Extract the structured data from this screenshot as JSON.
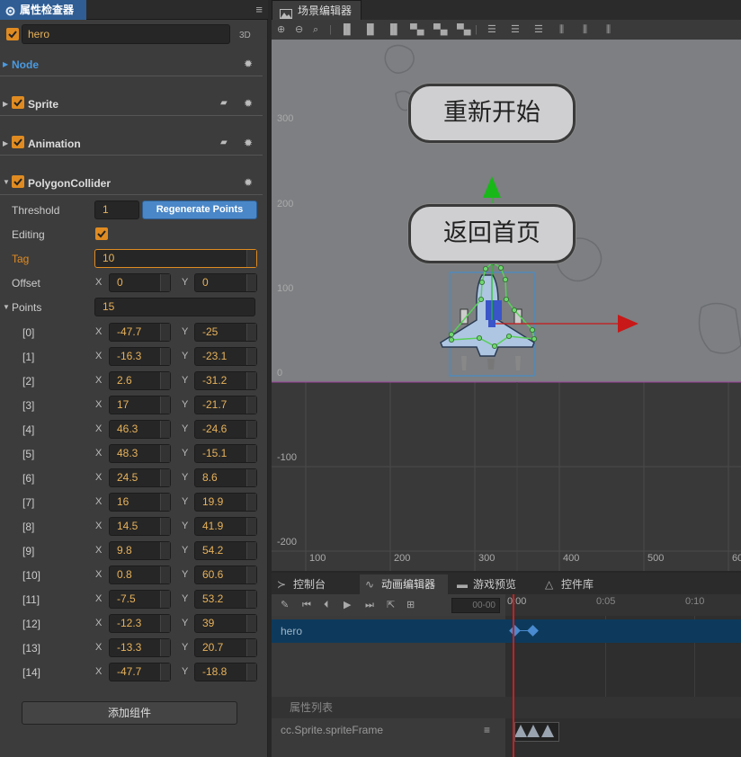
{
  "inspector": {
    "tab_label": "属性检查器",
    "node_name": "hero",
    "mode_3d": "3D",
    "sections": {
      "node": "Node",
      "sprite": "Sprite",
      "animation": "Animation",
      "polygon": "PolygonCollider"
    },
    "threshold_label": "Threshold",
    "threshold_value": "1",
    "regen_label": "Regenerate Points",
    "editing_label": "Editing",
    "tag_label": "Tag",
    "tag_value": "10",
    "offset_label": "Offset",
    "offset_x": "0",
    "offset_y": "0",
    "points_label": "Points",
    "points_count": "15",
    "x_label": "X",
    "y_label": "Y",
    "points": [
      {
        "idx": "[0]",
        "x": "-47.7",
        "y": "-25"
      },
      {
        "idx": "[1]",
        "x": "-16.3",
        "y": "-23.1"
      },
      {
        "idx": "[2]",
        "x": "2.6",
        "y": "-31.2"
      },
      {
        "idx": "[3]",
        "x": "17",
        "y": "-21.7"
      },
      {
        "idx": "[4]",
        "x": "46.3",
        "y": "-24.6"
      },
      {
        "idx": "[5]",
        "x": "48.3",
        "y": "-15.1"
      },
      {
        "idx": "[6]",
        "x": "24.5",
        "y": "8.6"
      },
      {
        "idx": "[7]",
        "x": "16",
        "y": "19.9"
      },
      {
        "idx": "[8]",
        "x": "14.5",
        "y": "41.9"
      },
      {
        "idx": "[9]",
        "x": "9.8",
        "y": "54.2"
      },
      {
        "idx": "[10]",
        "x": "0.8",
        "y": "60.6"
      },
      {
        "idx": "[11]",
        "x": "-7.5",
        "y": "53.2"
      },
      {
        "idx": "[12]",
        "x": "-12.3",
        "y": "39"
      },
      {
        "idx": "[13]",
        "x": "-13.3",
        "y": "20.7"
      },
      {
        "idx": "[14]",
        "x": "-47.7",
        "y": "-18.8"
      }
    ],
    "add_component": "添加组件"
  },
  "scene": {
    "tab_label": "场景编辑器",
    "y_ticks": [
      "300",
      "200",
      "100",
      "0",
      "-100",
      "-200"
    ],
    "x_ticks": [
      "100",
      "200",
      "300",
      "400",
      "500",
      "60"
    ],
    "btn_restart": "重新开始",
    "btn_home": "返回首页"
  },
  "bottom": {
    "tabs": [
      "控制台",
      "动画编辑器",
      "游戏预览",
      "控件库"
    ],
    "frame_value": "00-00",
    "timeline_labels": [
      "0:00",
      "0:05",
      "0:10"
    ],
    "node_row": "hero",
    "prop_list_label": "属性列表",
    "prop_item": "cc.Sprite.spriteFrame"
  },
  "colors": {
    "accent": "#e08b21",
    "value_text": "#e7b25b",
    "selection_blue": "#2f5d94",
    "button_blue": "#4a87c8"
  }
}
